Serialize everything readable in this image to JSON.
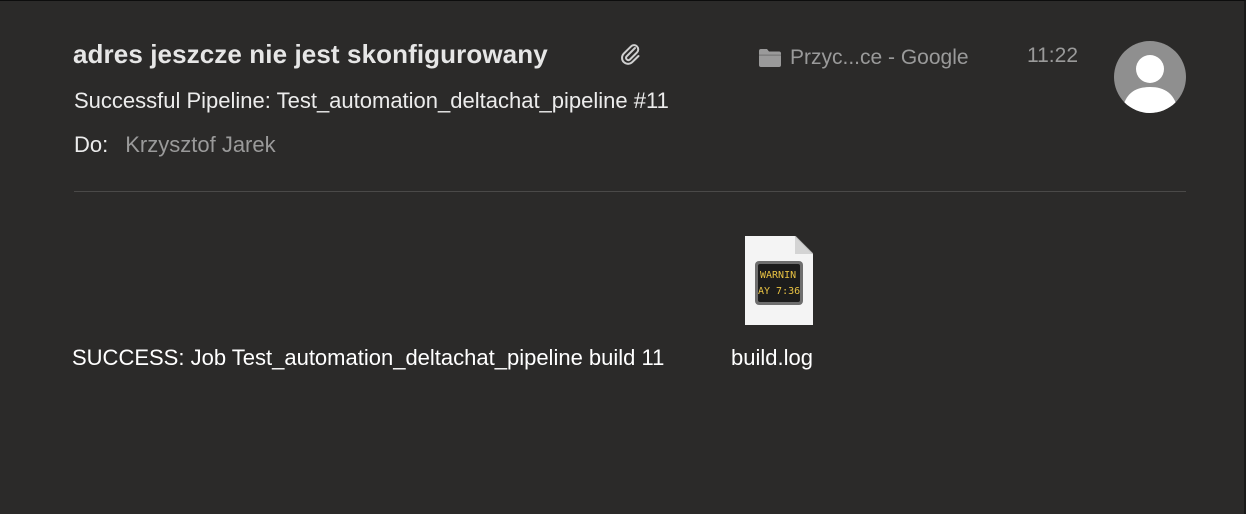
{
  "header": {
    "sender": "adres jeszcze nie jest skonfigurowany",
    "mailbox": "Przyc...ce - Google",
    "time": "11:22",
    "subject": "Successful Pipeline: Test_automation_deltachat_pipeline #11",
    "to_label": "Do:",
    "to_value": "Krzysztof Jarek"
  },
  "icons": {
    "attachment": "paperclip-icon",
    "mailbox": "folder-icon",
    "avatar": "person-icon",
    "file": "console-log-file-icon"
  },
  "body": {
    "text": "SUCCESS: Job Test_automation_deltachat_pipeline build 11",
    "attachment": {
      "name": "build.log",
      "preview_line1": "WARNIN",
      "preview_line2": "AY 7:36"
    }
  },
  "colors": {
    "background": "#2b2a29",
    "primary_text": "#ececec",
    "secondary_text": "#9a9a9a",
    "console_text": "#e8c243"
  }
}
